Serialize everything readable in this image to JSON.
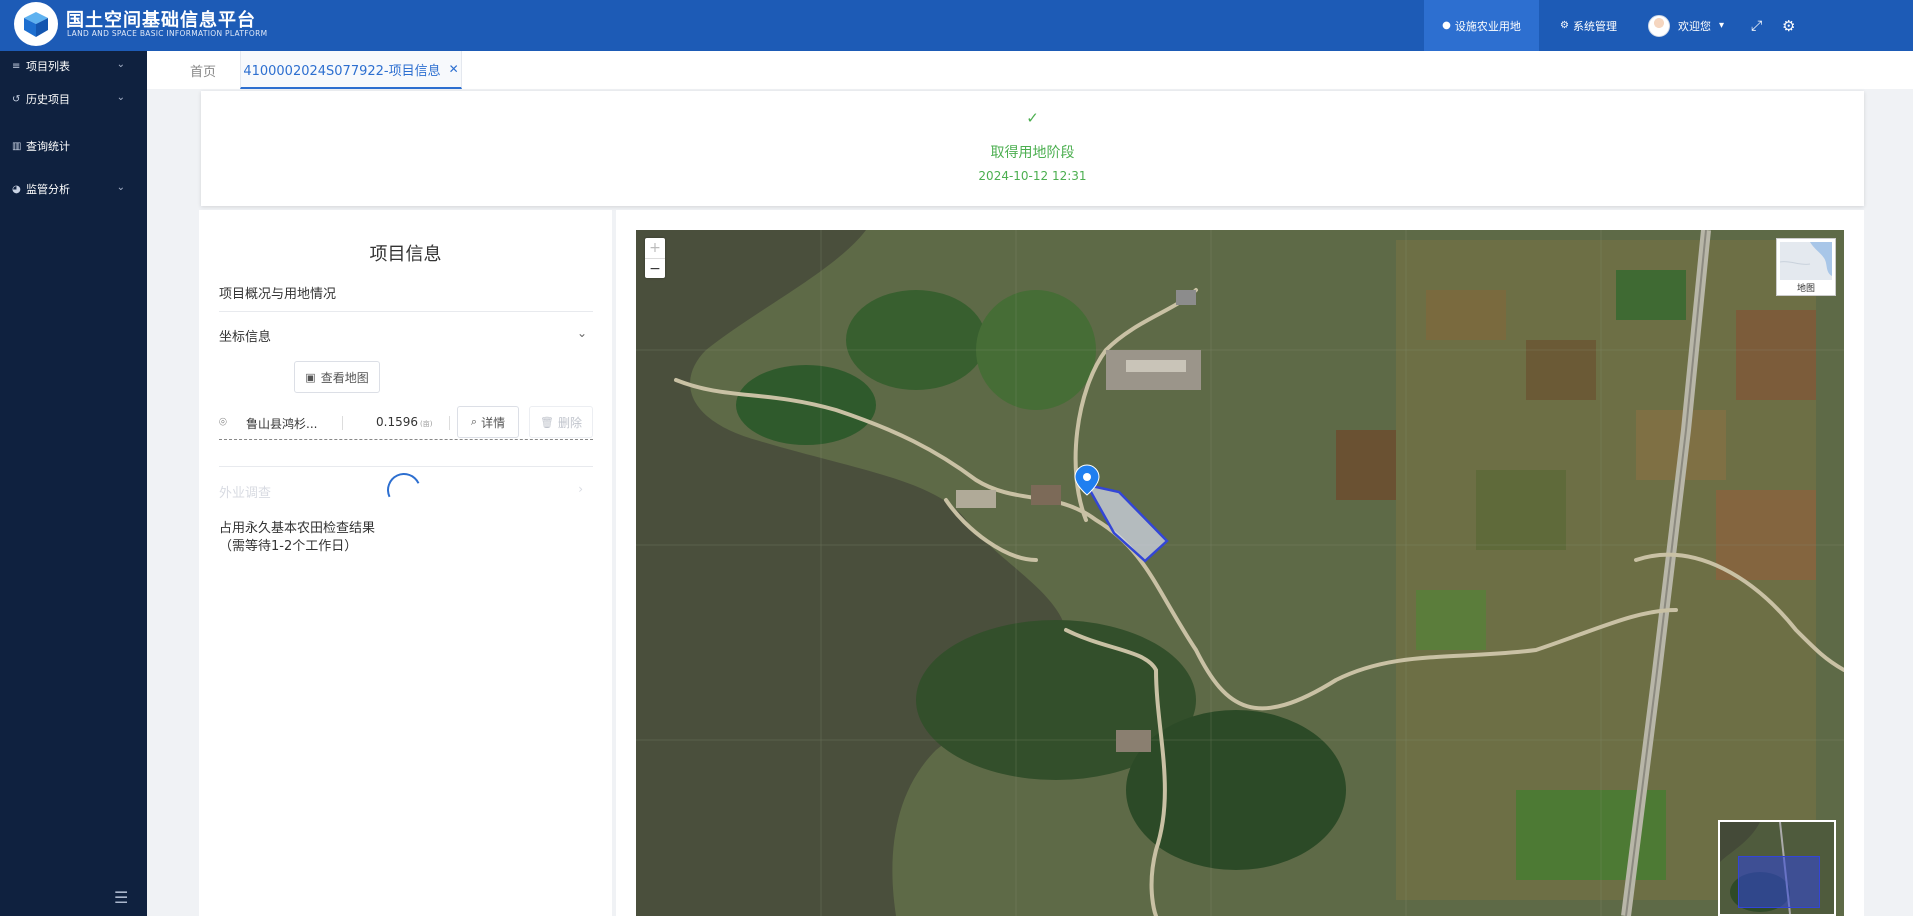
{
  "header": {
    "title": "国土空间基础信息平台",
    "subtitle": "LAND AND SPACE BASIC INFORMATION PLATFORM",
    "nav_active": "设施农业用地",
    "nav_system": "系统管理",
    "welcome": "欢迎您"
  },
  "sidebar": {
    "items": [
      {
        "label": "项目列表",
        "icon": "list-icon"
      },
      {
        "label": "历史项目",
        "icon": "history-icon"
      },
      {
        "label": "查询统计",
        "icon": "bar-chart-icon"
      },
      {
        "label": "监管分析",
        "icon": "pie-chart-icon"
      }
    ]
  },
  "tabs": {
    "home": "首页",
    "active": "4100002024S077922-项目信息"
  },
  "status": {
    "stage": "取得用地阶段",
    "time": "2024-10-12 12:31",
    "color": "#4caf50"
  },
  "project": {
    "title": "项目信息",
    "overview": "项目概况与用地情况",
    "coords_title": "坐标信息",
    "view_map": "查看地图",
    "coord_name": "鲁山县鸿杉...",
    "coord_area": "0.1596",
    "coord_unit": "(亩)",
    "detail": "详情",
    "delete": "删除",
    "field_survey": "外业调查",
    "farmland_result": "占用永久基本农田检查结果",
    "farmland_note": "（需等待1-2个工作日）"
  },
  "map": {
    "basemap_label": "地图",
    "zoom_in": "+",
    "zoom_out": "−"
  },
  "colors": {
    "header": "#1d5bb6",
    "sidebar": "#0f213f",
    "accent": "#2d6fd0",
    "success": "#4caf50"
  }
}
